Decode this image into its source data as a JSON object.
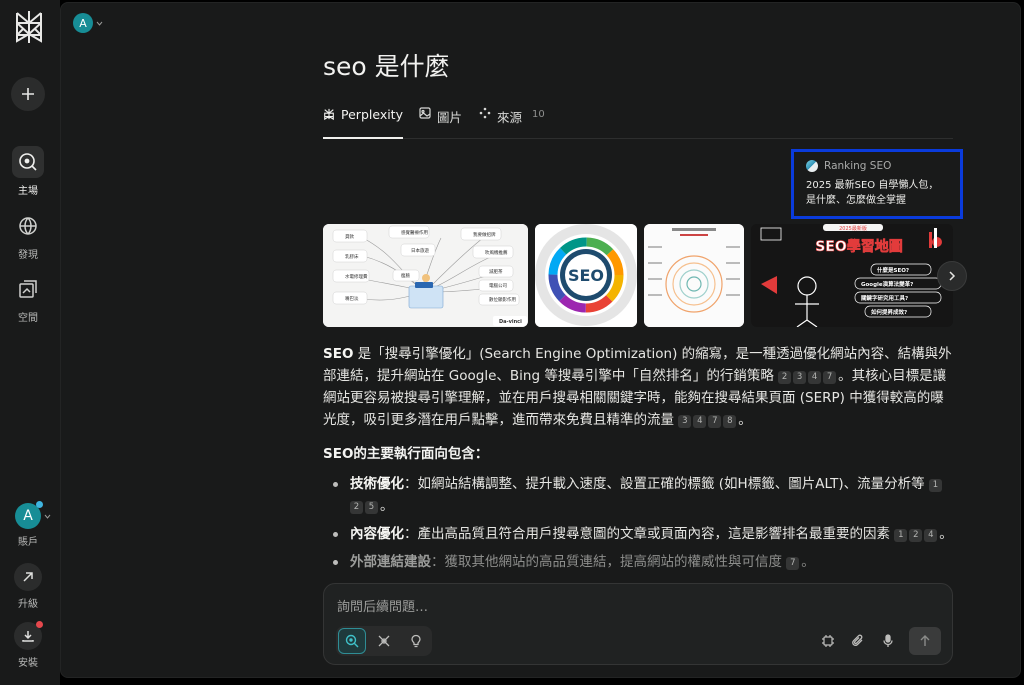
{
  "rail": {
    "nav": [
      {
        "label": "主場",
        "icon": "search-circle-icon",
        "active": true
      },
      {
        "label": "發現",
        "icon": "globe-icon",
        "active": false
      },
      {
        "label": "空間",
        "icon": "spaces-icon",
        "active": false
      }
    ],
    "account": {
      "avatar_letter": "A",
      "label": "賬戶"
    },
    "upgrade": {
      "label": "升級"
    },
    "install": {
      "label": "安裝"
    }
  },
  "header": {
    "avatar_letter": "A"
  },
  "question": "seo 是什麼",
  "tabs": [
    {
      "label": "Perplexity",
      "active": true
    },
    {
      "label": "圖片",
      "active": false
    },
    {
      "label": "來源",
      "count": "10",
      "active": false
    }
  ],
  "source_card": {
    "site": "Ranking SEO",
    "title_line1": "2025 最新SEO 自學懶人包，",
    "title_line2": "是什麼、怎麼做全掌握"
  },
  "images": {
    "img1_tags": [
      "貸款",
      "感覺醫療作用",
      "我要做招牌",
      "乳膠床",
      "日本旅遊",
      "吹風機推薦",
      "水電修理費",
      "嘴巴淡",
      "減肥茶",
      "電腦公司",
      "瘦臉",
      "數位顯影作用"
    ],
    "img1_brand": "Da-vinci",
    "img2_center": "SEO",
    "img4_title": "SEO學習地圖",
    "img4_badge": "2025最新版",
    "img4_bubbles": [
      "什麼是SEO?",
      "Google演算法變革?",
      "關鍵字研究用工具?",
      "如何提昇成效?"
    ]
  },
  "answer": {
    "p1_lead": "SEO",
    "p1_text_a": " 是「搜尋引擎優化」(Search Engine Optimization) 的縮寫，是一種透過優化網站內容、結構與外部連結，提升網站在 Google、Bing 等搜尋引擎中「自然排名」的行銷策略",
    "p1_cites_a": [
      "2",
      "3",
      "4",
      "7"
    ],
    "p1_text_b": "。其核心目標是讓網站更容易被搜尋引擎理解，並在用戶搜尋相關關鍵字時，能夠在搜尋結果頁面 (SERP) 中獲得較高的曝光度，吸引更多潛在用戶點擊，進而帶來免費且精準的流量",
    "p1_cites_b": [
      "3",
      "4",
      "7",
      "8"
    ],
    "p1_end": "。",
    "section_title": "SEO的主要執行面向包含：",
    "points": [
      {
        "title": "技術優化",
        "text": "：如網站結構調整、提升載入速度、設置正確的標籤 (如H標籤、圖片ALT)、流量分析等",
        "cites": [
          "1",
          "2",
          "5"
        ],
        "end": "。"
      },
      {
        "title": "內容優化",
        "text": "：產出高品質且符合用戶搜尋意圖的文章或頁面內容，這是影響排名最重要的因素",
        "cites": [
          "1",
          "2",
          "4"
        ],
        "end": "。"
      },
      {
        "title": "外部連結建設",
        "text": "：獲取其他網站的高品質連結，提高網站的權威性與可信度",
        "cites": [
          "7"
        ],
        "end": "。"
      }
    ]
  },
  "composer": {
    "placeholder": "詢問后續問題…"
  },
  "colors": {
    "accent": "#178d96",
    "highlight_border": "#0a3bdc",
    "notify_red": "#e5484d",
    "notify_blue": "#3fb5e0"
  }
}
